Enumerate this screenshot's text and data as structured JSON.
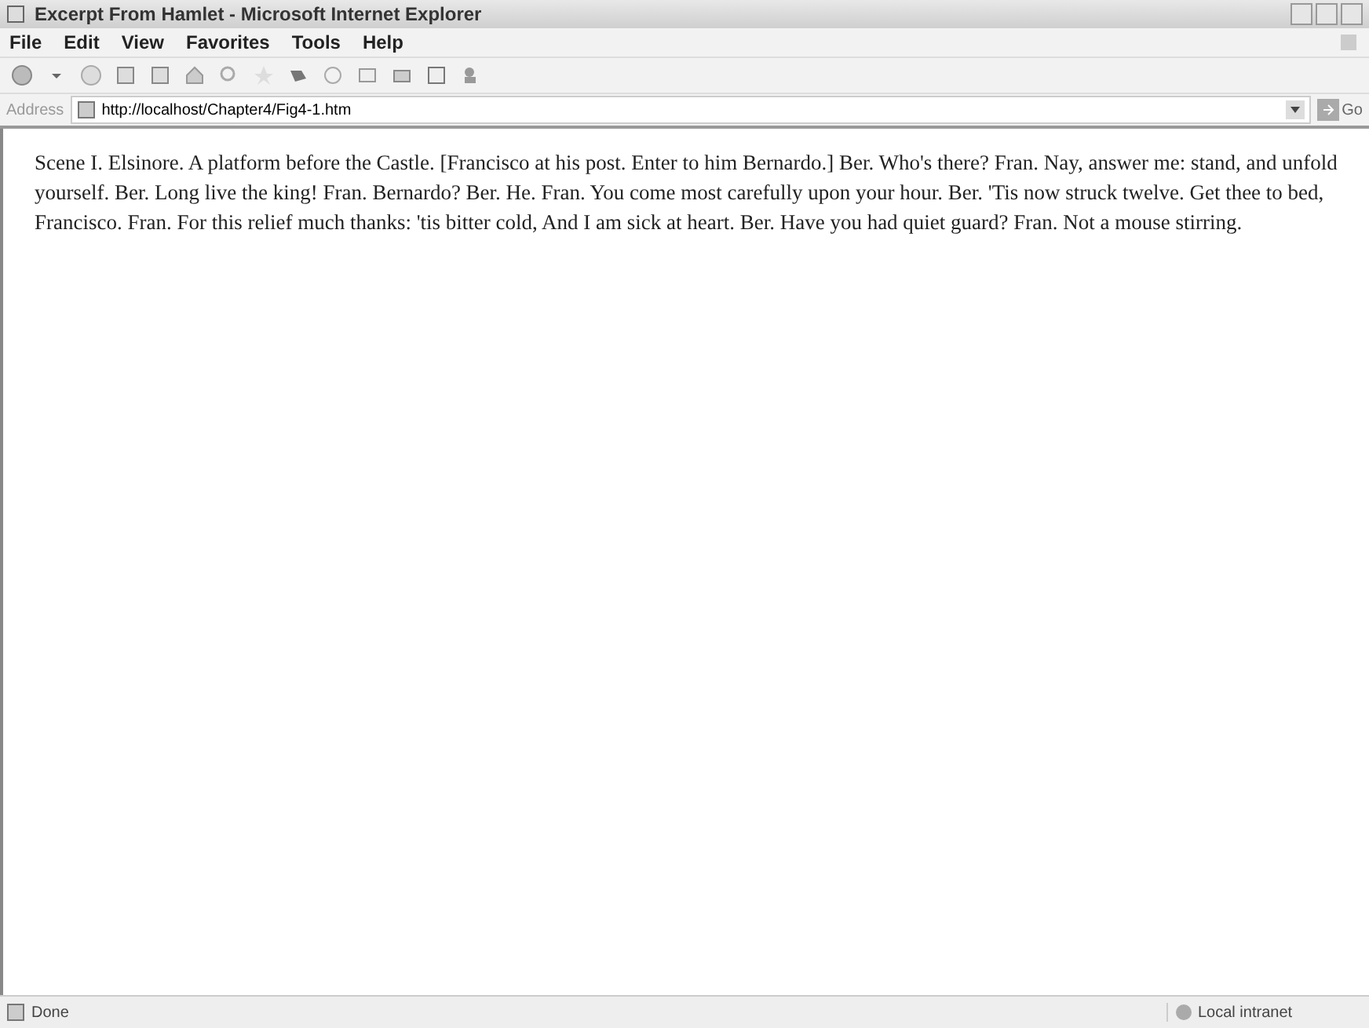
{
  "window": {
    "title": "Excerpt From Hamlet - Microsoft Internet Explorer"
  },
  "menu": [
    "File",
    "Edit",
    "View",
    "Favorites",
    "Tools",
    "Help"
  ],
  "address_bar": {
    "label": "Address",
    "value": "http://localhost/Chapter4/Fig4-1.htm",
    "go": "Go"
  },
  "content": {
    "text": "Scene I. Elsinore. A platform before the Castle. [Francisco at his post. Enter to him Bernardo.] Ber. Who's there? Fran. Nay, answer me: stand, and unfold yourself. Ber. Long live the king! Fran. Bernardo? Ber. He. Fran. You come most carefully upon your hour. Ber. 'Tis now struck twelve. Get thee to bed, Francisco. Fran. For this relief much thanks: 'tis bitter cold, And I am sick at heart. Ber. Have you had quiet guard? Fran. Not a mouse stirring."
  },
  "status_bar": {
    "status": "Done",
    "zone": "Local intranet"
  }
}
